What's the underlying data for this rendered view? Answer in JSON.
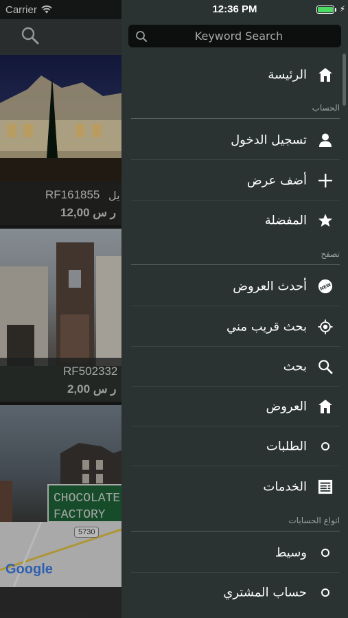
{
  "background": {
    "status": {
      "carrier": "Carrier"
    },
    "listings": [
      {
        "rf": "RF161855",
        "prefix": "يل",
        "price": "12,00",
        "currency": "ر س"
      },
      {
        "rf": "RF502332",
        "prefix": "",
        "price": "2,00",
        "currency": "ر س"
      },
      {
        "sign_line1": "CHOCOLATE",
        "sign_line2": "FACTORY"
      }
    ],
    "map": {
      "route": "5730",
      "brand": "Google"
    }
  },
  "drawer": {
    "status": {
      "time": "12:36 PM",
      "battery_level": 1.0
    },
    "search": {
      "placeholder": "Keyword Search"
    },
    "home": {
      "label": "الرئيسة",
      "icon": "home-icon"
    },
    "sections": {
      "account": "الحساب",
      "browse": "تصفح",
      "account_types": "انواع الحسابات"
    },
    "account_items": [
      {
        "label": "تسجيل الدخول",
        "icon": "person-icon"
      },
      {
        "label": "أضف عرض",
        "icon": "plus-icon"
      },
      {
        "label": "المفضلة",
        "icon": "star-icon"
      }
    ],
    "browse_items": [
      {
        "label": "أحدث العروض",
        "icon": "new-badge-icon"
      },
      {
        "label": "بحث قريب مني",
        "icon": "location-target-icon"
      },
      {
        "label": "بحث",
        "icon": "search-icon"
      },
      {
        "label": "العروض",
        "icon": "home-icon"
      },
      {
        "label": "الطلبات",
        "icon": "circle-icon"
      },
      {
        "label": "الخدمات",
        "icon": "services-icon"
      }
    ],
    "account_type_items": [
      {
        "label": "وسيط",
        "icon": "circle-icon"
      },
      {
        "label": "حساب المشتري",
        "icon": "circle-icon"
      }
    ]
  },
  "colors": {
    "drawer_bg": "#2a3232",
    "search_bg": "#0d0f0f",
    "battery": "#4cd964"
  }
}
